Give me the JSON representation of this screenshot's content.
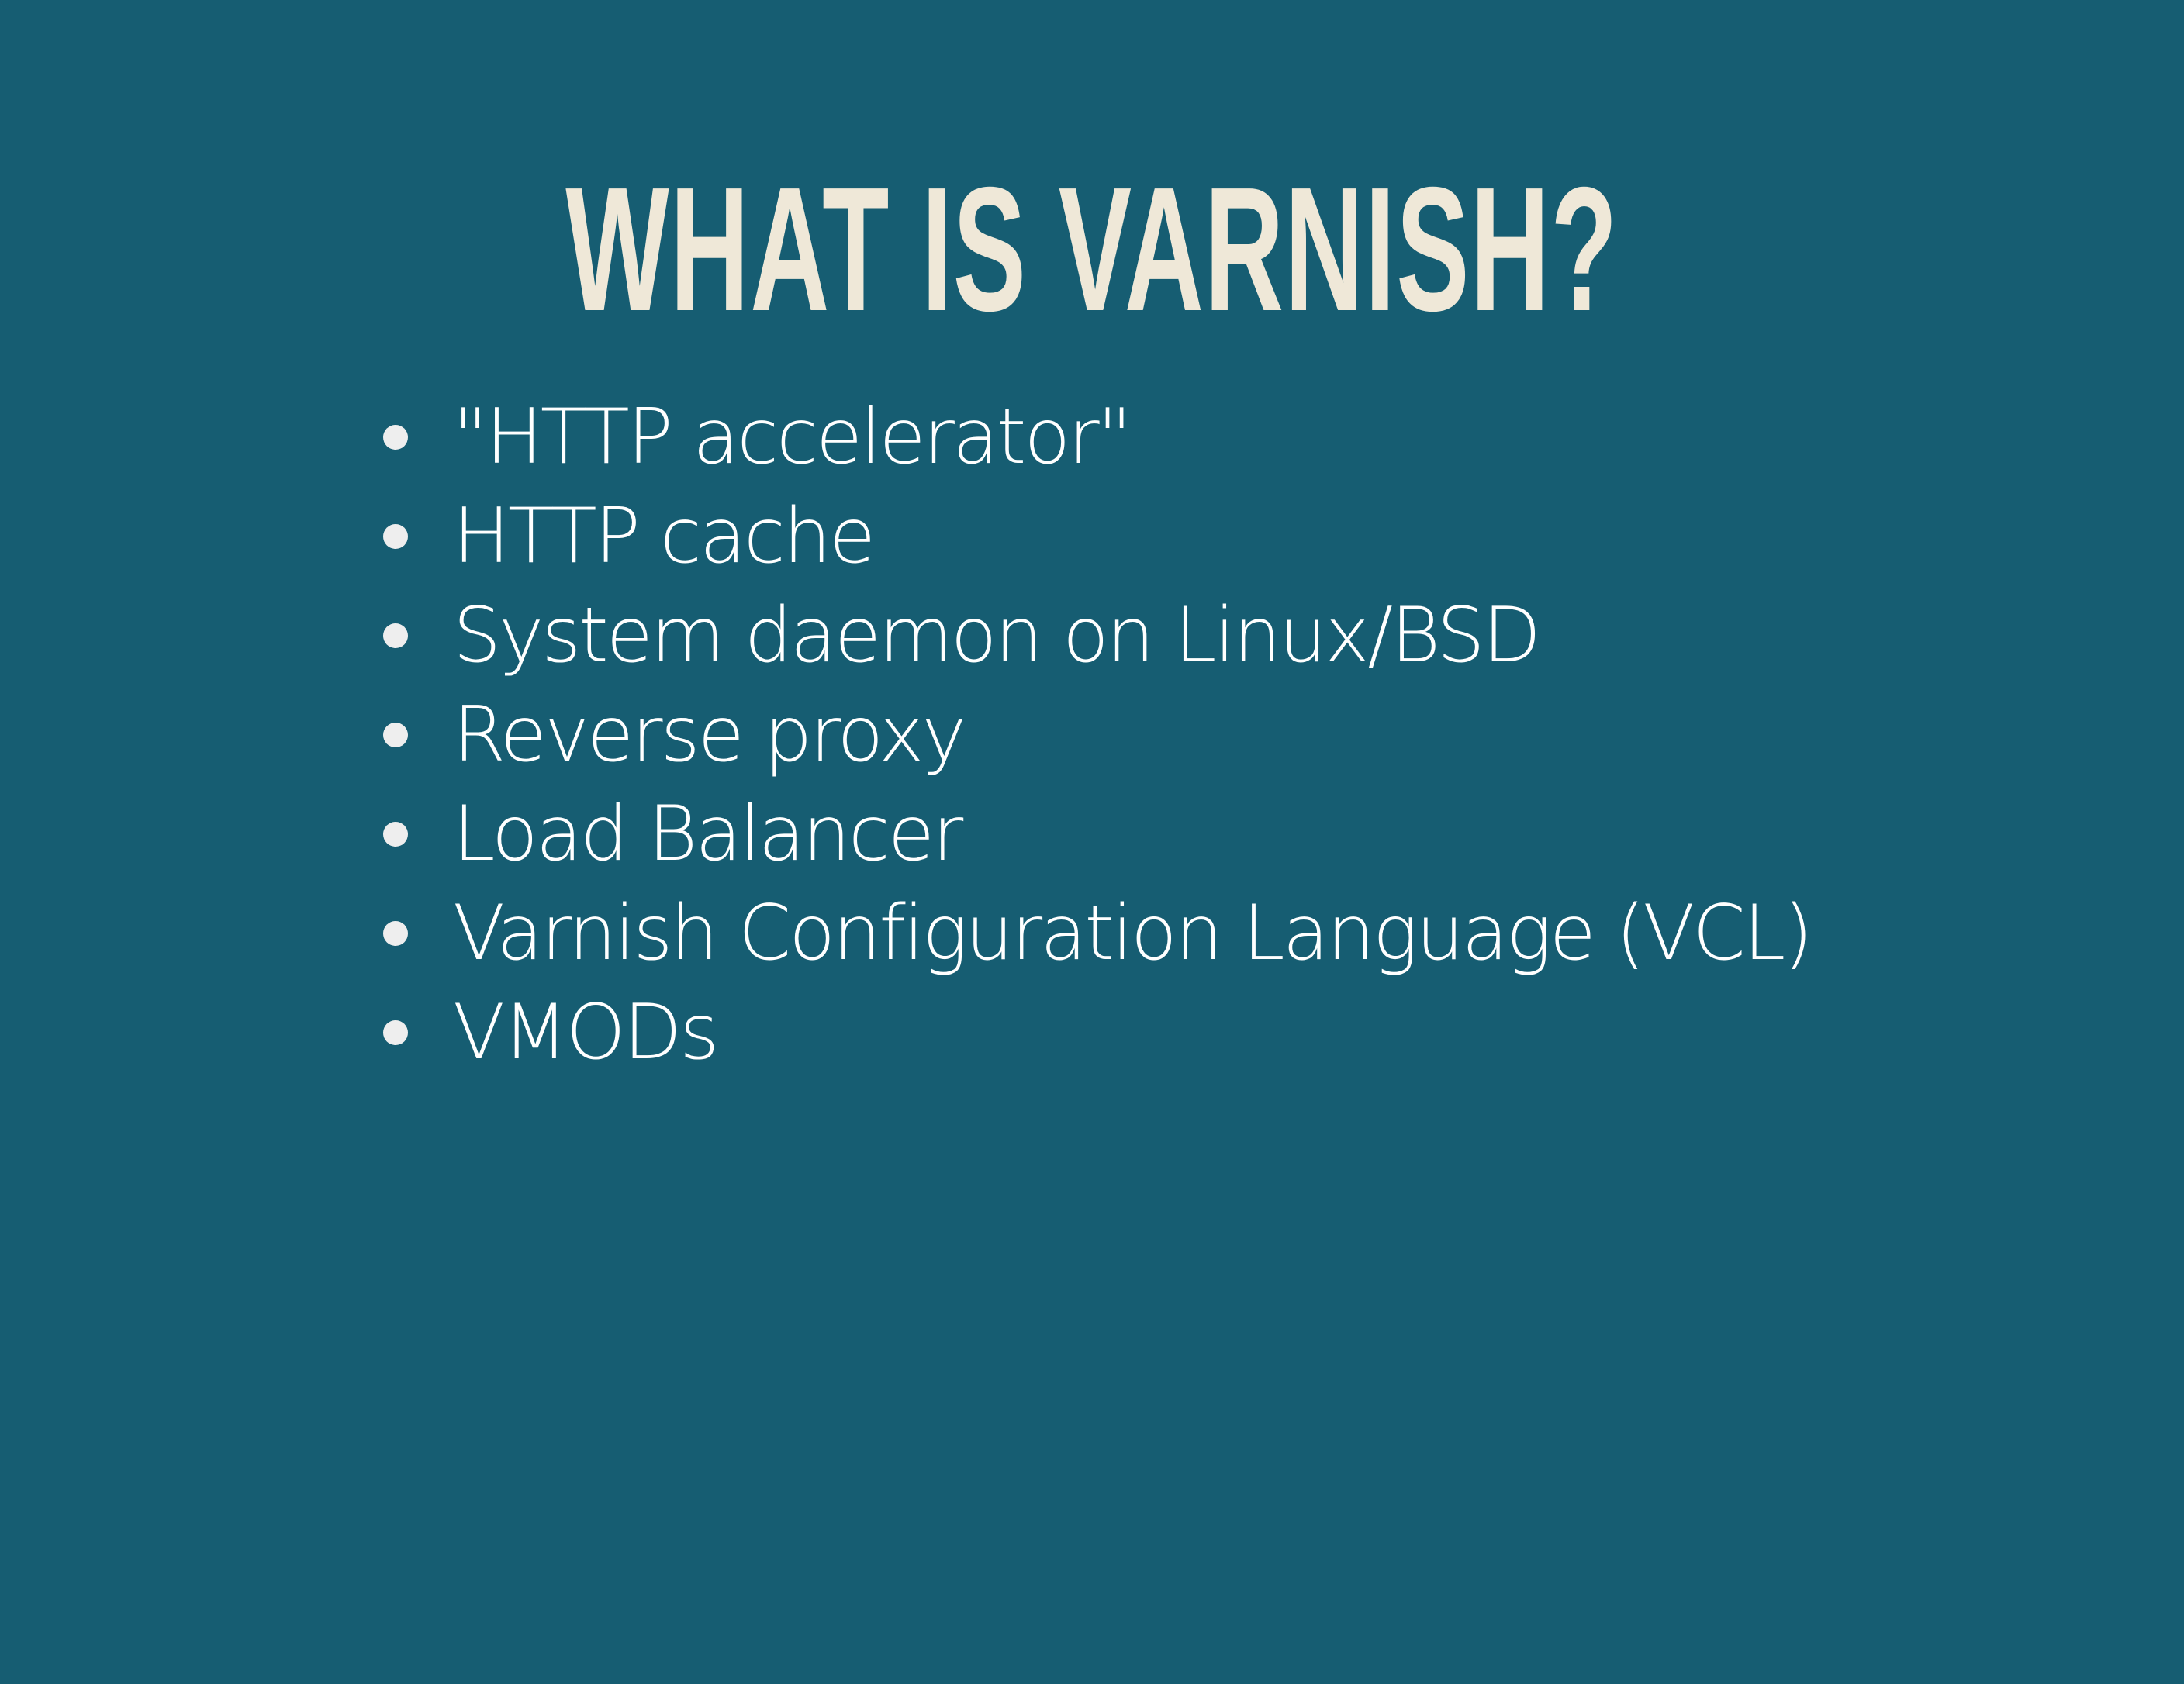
{
  "slide": {
    "title": "WHAT IS VARNISH?",
    "bullets": [
      "\"HTTP accelerator\"",
      "HTTP cache",
      "System daemon on Linux/BSD",
      "Reverse proxy",
      "Load Balancer",
      "Varnish Configuration Language (VCL)",
      "VMODs"
    ]
  },
  "colors": {
    "background": "#165d72",
    "title": "#efe8d8",
    "text": "#ffffff",
    "bullet": "#eeeeee"
  }
}
